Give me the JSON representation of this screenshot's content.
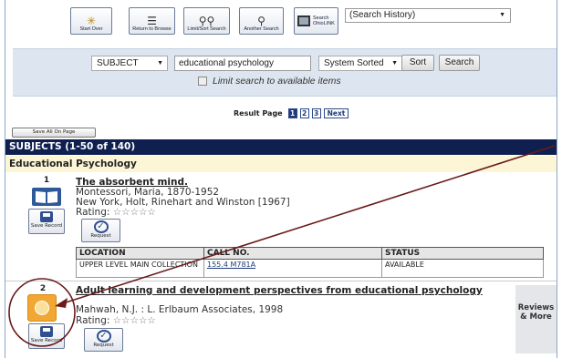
{
  "toolbar": {
    "start_over": "Start Over",
    "return_browse": "Return to Browse",
    "limit_sort": "Limit/Sort Search",
    "another_search": "Another Search",
    "search_ohiolink_line1": "Search",
    "search_ohiolink_line2": "OhioLINK",
    "history_select": "(Search History)"
  },
  "search": {
    "type_select": "SUBJECT",
    "query": "educational psychology",
    "sort_select": "System Sorted",
    "sort_button": "Sort",
    "search_button": "Search",
    "limit_label": "Limit search to available items"
  },
  "paging": {
    "label": "Result Page",
    "pages": [
      "1",
      "2",
      "3"
    ],
    "next": "Next"
  },
  "save_all": "Save All On Page",
  "subjects_header": "SUBJECTS (1-50 of 140)",
  "group_header": "Educational Psychology",
  "records": [
    {
      "number": "1",
      "title": "The absorbent mind.",
      "author": "Montessori, Maria, 1870-1952",
      "publication": "New York, Holt, Rinehart and Winston [1967]",
      "rating_label": "Rating:",
      "save_label": "Save Record",
      "request_label": "Request",
      "holdings_headers": [
        "LOCATION",
        "CALL NO.",
        "STATUS"
      ],
      "holdings": [
        {
          "location": "UPPER LEVEL MAIN COLLECTION",
          "call_no": "155.4 M781A",
          "status": "AVAILABLE"
        }
      ]
    },
    {
      "number": "2",
      "title": "Adult learning and development perspectives from educational psychology",
      "publication": "Mahwah, N.J. : L. Erlbaum Associates, 1998",
      "rating_label": "Rating:",
      "save_label": "Save Record",
      "request_label": "Request",
      "reviews_label_1": "Reviews",
      "reviews_label_2": "& More"
    }
  ],
  "rating_stars": "☆☆☆☆☆",
  "colors": {
    "header_navy": "#0f2050",
    "group_cream": "#fdf6d6",
    "panel_blue": "#dde6f0",
    "annotation": "#6b1a1a"
  }
}
